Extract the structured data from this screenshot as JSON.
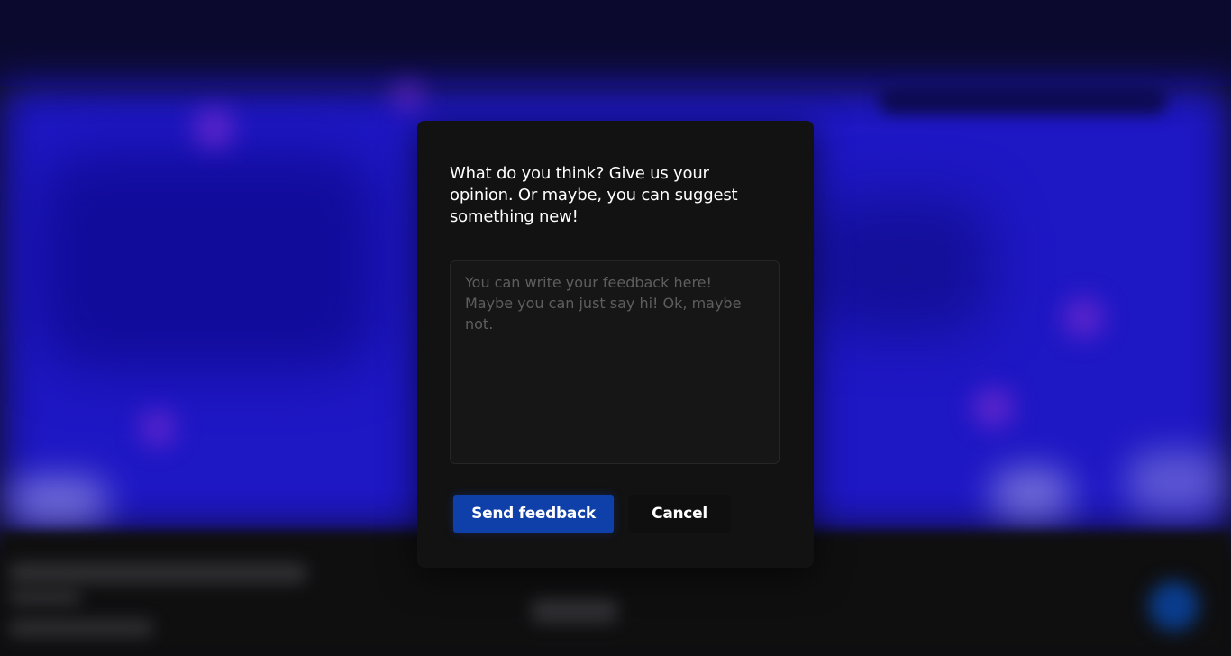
{
  "feedback_dialog": {
    "prompt": "What do you think? Give us your opinion. Or maybe, you can suggest something new!",
    "input": {
      "value": "",
      "placeholder": "You can write your feedback here! Maybe you can just say hi! Ok, maybe not."
    },
    "send_label": "Send feedback",
    "cancel_label": "Cancel"
  },
  "colors": {
    "dialog_background": "#121212",
    "primary_button": "#0f3fa8",
    "backdrop_accent": "#1e17c4"
  }
}
